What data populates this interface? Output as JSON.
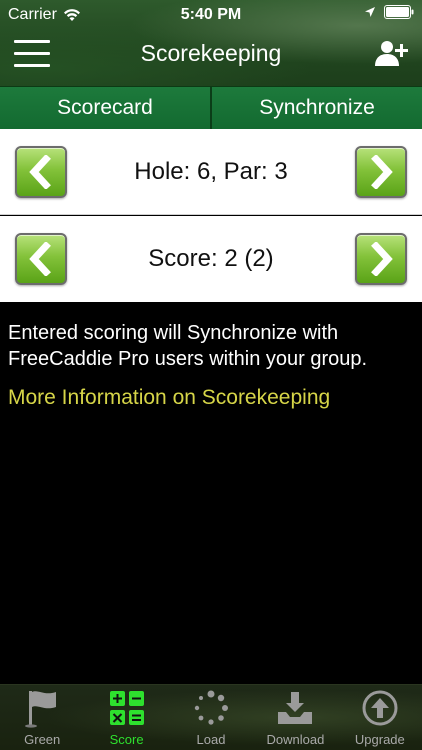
{
  "status_bar": {
    "carrier": "Carrier",
    "time": "5:40 PM"
  },
  "header": {
    "title": "Scorekeeping"
  },
  "segments": [
    {
      "label": "Scorecard"
    },
    {
      "label": "Synchronize"
    }
  ],
  "hole_row": {
    "label": "Hole: 6, Par: 3"
  },
  "score_row": {
    "label": "Score: 2 (2)"
  },
  "info": {
    "message": "Entered scoring will Synchronize with FreeCaddie Pro users within your group.",
    "link": "More Information on Scorekeeping"
  },
  "tabs": [
    {
      "label": "Green",
      "icon": "flag-icon"
    },
    {
      "label": "Score",
      "icon": "calculator-icon"
    },
    {
      "label": "Load",
      "icon": "spinner-icon"
    },
    {
      "label": "Download",
      "icon": "download-tray-icon"
    },
    {
      "label": "Upgrade",
      "icon": "up-arrow-circle-icon"
    }
  ],
  "colors": {
    "segment_green": "#1d7a3c",
    "arrow_green": "#83c23a",
    "link_yellow": "#d6d548",
    "active_tab": "#2ee02e"
  }
}
